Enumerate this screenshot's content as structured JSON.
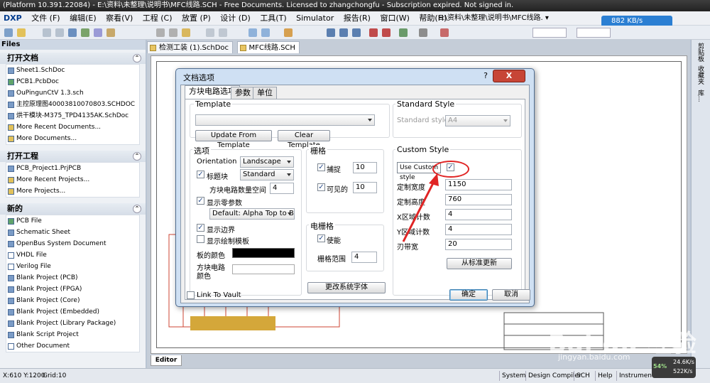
{
  "window": {
    "title": "(Platform 10.391.22084) - E:\\资料\\未整理\\说明书\\MFC线路.SCH - Free Documents. Licensed to zhangchongfu - Subscription expired. Not signed in."
  },
  "menubar": {
    "items": [
      "DXP",
      "文件 (F)",
      "编辑(E)",
      "察看(V)",
      "工程 (C)",
      "放置 (P)",
      "设计 (D)",
      "工具(T)",
      "Simulator",
      "报告(R)",
      "窗口(W)",
      "帮助(H)"
    ],
    "path": "E:\\资料\\未整理\\说明书\\MFC线路. ▾"
  },
  "network_speed": "882 KB/s",
  "files_panel": {
    "header": "Files",
    "sections": [
      {
        "title": "打开文档",
        "items": [
          "Sheet1.SchDoc",
          "PCB1.PcbDoc",
          "OuPingunCtV 1.3.sch",
          "主控原理图40003810070803.SCHDOC",
          "烘干模块-M375_TPD4135AK.SchDoc",
          "More Recent Documents...",
          "More Documents..."
        ]
      },
      {
        "title": "打开工程",
        "items": [
          "PCB_Project1.PrjPCB",
          "More Recent Projects...",
          "More Projects..."
        ]
      },
      {
        "title": "新的",
        "items": [
          "PCB File",
          "Schematic Sheet",
          "OpenBus System Document",
          "VHDL File",
          "Verilog File",
          "Blank Project (PCB)",
          "Blank Project (FPGA)",
          "Blank Project (Core)",
          "Blank Project (Embedded)",
          "Blank Project (Library Package)",
          "Blank Script Project",
          "Other Document"
        ]
      }
    ]
  },
  "doc_tabs": [
    "检测工装 (1).SchDoc",
    "MFC线路.SCH"
  ],
  "editor_tab": "Editor",
  "right_strip": [
    "剪贴板",
    "收藏夹",
    "库..."
  ],
  "dialog": {
    "title": "文档选项",
    "help": "?",
    "close": "X",
    "tabs": [
      "方块电路选项",
      "参数",
      "单位"
    ],
    "template": {
      "group": "Template",
      "value": "",
      "update_btn": "Update From Template",
      "clear_btn": "Clear Template"
    },
    "standard_style": {
      "group": "Standard Style",
      "label": "Standard styles",
      "value": "A4"
    },
    "options": {
      "group": "选项",
      "orientation_label": "Orientation",
      "orientation_value": "Landscape",
      "title_block_label": "标题块",
      "title_block_value": "Standard",
      "title_block_checked": true,
      "sheet_number_label": "方块电路数量空间",
      "sheet_number_value": "4",
      "show_ref_zones_label": "显示零参数",
      "show_ref_zones_checked": true,
      "ref_zone_value": "Default: Alpha Top to Bottom,",
      "show_border_label": "显示边界",
      "show_border_checked": true,
      "show_template_graphics_label": "显示绘制模板",
      "show_template_graphics_checked": false,
      "border_color_label": "板的颜色",
      "sheet_color_label": "方块电路颜色",
      "border_color": "#000000",
      "sheet_color": "#ffffff"
    },
    "grids": {
      "group": "栅格",
      "snap_label": "捕捉",
      "snap_checked": true,
      "snap_value": "10",
      "visible_label": "可见的",
      "visible_checked": true,
      "visible_value": "10"
    },
    "electrical_grid": {
      "group": "电栅格",
      "enable_label": "使能",
      "enable_checked": true,
      "range_label": "栅格范围",
      "range_value": "4"
    },
    "change_font_btn": "更改系统字体",
    "custom_style": {
      "group": "Custom Style",
      "use_label": "Use Custom style",
      "use_checked": true,
      "width_label": "定制宽度",
      "width_value": "1150",
      "height_label": "定制高度",
      "height_value": "760",
      "x_ref_label": "X区域计数",
      "x_ref_value": "4",
      "y_ref_label": "Y区域计数",
      "y_ref_value": "4",
      "margin_label": "刃带宽",
      "margin_value": "20",
      "update_btn": "从标准更新"
    },
    "link_to_vault": "Link To Vault",
    "link_checked": false,
    "ok_btn": "确定",
    "cancel_btn": "取消"
  },
  "statusbar": {
    "coords": "X:610 Y:1200",
    "grid": "Grid:10",
    "buttons": [
      "System",
      "Design Compiler",
      "SCH",
      "Help",
      "Instruments"
    ]
  },
  "watermark": {
    "text": "Bai du 经验",
    "sub": "jingyan.baidu.com"
  },
  "net_widget": {
    "percent": "54%",
    "up": "24.6K/s",
    "down": "522K/s"
  },
  "colors": {
    "accent": "#2b7fd3",
    "annotation": "#e02424",
    "close": "#c74536"
  }
}
